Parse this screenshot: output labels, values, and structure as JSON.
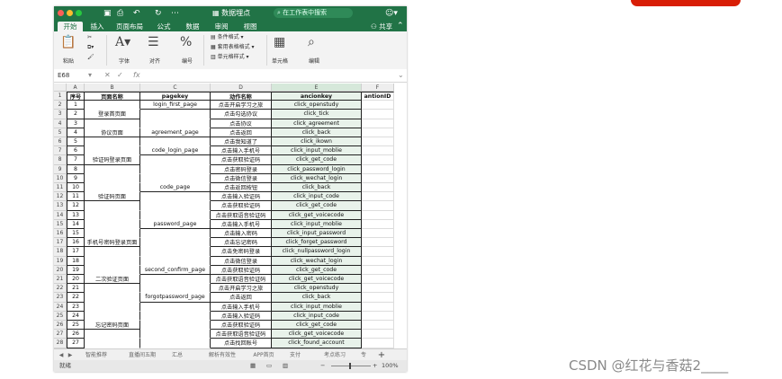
{
  "window": {
    "title": "数据埋点",
    "search_placeholder": "在工作表中搜索"
  },
  "ribbon_tabs": [
    "开始",
    "插入",
    "页面布局",
    "公式",
    "数据",
    "审阅",
    "视图"
  ],
  "share_label": "共享",
  "ribbon": {
    "paste": "粘贴",
    "font": "字体",
    "align": "对齐",
    "number": "编号",
    "conditional_format": "条件格式",
    "table_format": "套用表格格式",
    "cell_style": "单元格样式",
    "cells": "单元格",
    "edit": "编辑"
  },
  "formula_bar": {
    "name_box": "E68",
    "fx": "fx"
  },
  "columns": [
    "A",
    "B",
    "C",
    "D",
    "E",
    "F"
  ],
  "header_row": [
    "序号",
    "页面名称",
    "pagekey",
    "动作名称",
    "ancionkey",
    "antionID"
  ],
  "rows": [
    {
      "n": "1",
      "page": "",
      "pagekey": "login_first_page",
      "action": "点击开启学习之旅",
      "key": "click_openstudy"
    },
    {
      "n": "2",
      "page": "登录首页面",
      "pagekey": "",
      "action": "点击勾选协议",
      "key": "click_tick"
    },
    {
      "n": "3",
      "page": "",
      "pagekey": "",
      "action": "点击协议",
      "key": "click_agreement"
    },
    {
      "n": "4",
      "page": "协议页面",
      "pagekey": "agreement_page",
      "action": "点击返回",
      "key": "click_back"
    },
    {
      "n": "5",
      "page": "",
      "pagekey": "",
      "action": "点击我知道了",
      "key": "click_ikown"
    },
    {
      "n": "6",
      "page": "",
      "pagekey": "code_login_page",
      "action": "点击输入手机号",
      "key": "click_input_moblie"
    },
    {
      "n": "7",
      "page": "验证码登录页面",
      "pagekey": "",
      "action": "点击获取验证码",
      "key": "click_get_code"
    },
    {
      "n": "8",
      "page": "",
      "pagekey": "",
      "action": "点击密码登录",
      "key": "click_password_login"
    },
    {
      "n": "9",
      "page": "",
      "pagekey": "",
      "action": "点击微信登录",
      "key": "click_wechat_login"
    },
    {
      "n": "10",
      "page": "",
      "pagekey": "code_page",
      "action": "点击返回按钮",
      "key": "click_back"
    },
    {
      "n": "11",
      "page": "验证码页面",
      "pagekey": "",
      "action": "点击输入验证码",
      "key": "click_input_code"
    },
    {
      "n": "12",
      "page": "",
      "pagekey": "",
      "action": "点击获取验证码",
      "key": "click_get_code"
    },
    {
      "n": "13",
      "page": "",
      "pagekey": "",
      "action": "点击获取语音验证码",
      "key": "click_get_voicecode"
    },
    {
      "n": "14",
      "page": "",
      "pagekey": "password_page",
      "action": "点击输入手机号",
      "key": "click_input_moblie"
    },
    {
      "n": "15",
      "page": "",
      "pagekey": "",
      "action": "点击输入密码",
      "key": "click_input_password"
    },
    {
      "n": "16",
      "page": "手机号密码登录页面",
      "pagekey": "",
      "action": "点击忘记密码",
      "key": "click_forget_password"
    },
    {
      "n": "17",
      "page": "",
      "pagekey": "",
      "action": "点击免密码登录",
      "key": "click_nullpassword_login"
    },
    {
      "n": "18",
      "page": "",
      "pagekey": "",
      "action": "点击微信登录",
      "key": "click_wechat_login"
    },
    {
      "n": "19",
      "page": "",
      "pagekey": "second_confirm_page",
      "action": "点击获取验证码",
      "key": "click_get_code"
    },
    {
      "n": "20",
      "page": "二次验证页面",
      "pagekey": "",
      "action": "点击获取语音验证码",
      "key": "click_get_voicecode"
    },
    {
      "n": "21",
      "page": "",
      "pagekey": "",
      "action": "点击开启学习之旅",
      "key": "click_openstudy"
    },
    {
      "n": "22",
      "page": "",
      "pagekey": "forgotpassword_page",
      "action": "点击返回",
      "key": "click_back"
    },
    {
      "n": "23",
      "page": "",
      "pagekey": "",
      "action": "点击输入手机号",
      "key": "click_input_moblie"
    },
    {
      "n": "24",
      "page": "",
      "pagekey": "",
      "action": "点击输入验证码",
      "key": "click_input_code"
    },
    {
      "n": "25",
      "page": "忘记密码页面",
      "pagekey": "",
      "action": "点击获取验证码",
      "key": "click_get_code"
    },
    {
      "n": "26",
      "page": "",
      "pagekey": "",
      "action": "点击获取语音验证码",
      "key": "click_get_voicecode"
    },
    {
      "n": "27",
      "page": "",
      "pagekey": "",
      "action": "点击找回账号",
      "key": "click_found_account"
    }
  ],
  "sheet_tabs": [
    "智能推荐",
    "直播间五期",
    "汇总",
    "解析有效性",
    "APP首页",
    "支付",
    "考点练习",
    "专"
  ],
  "status": {
    "ready": "就绪",
    "zoom": "100%"
  },
  "watermark": "CSDN @红花与香菇2____",
  "colors": {
    "excel_green": "#217346",
    "red_button": "#d81e06"
  }
}
